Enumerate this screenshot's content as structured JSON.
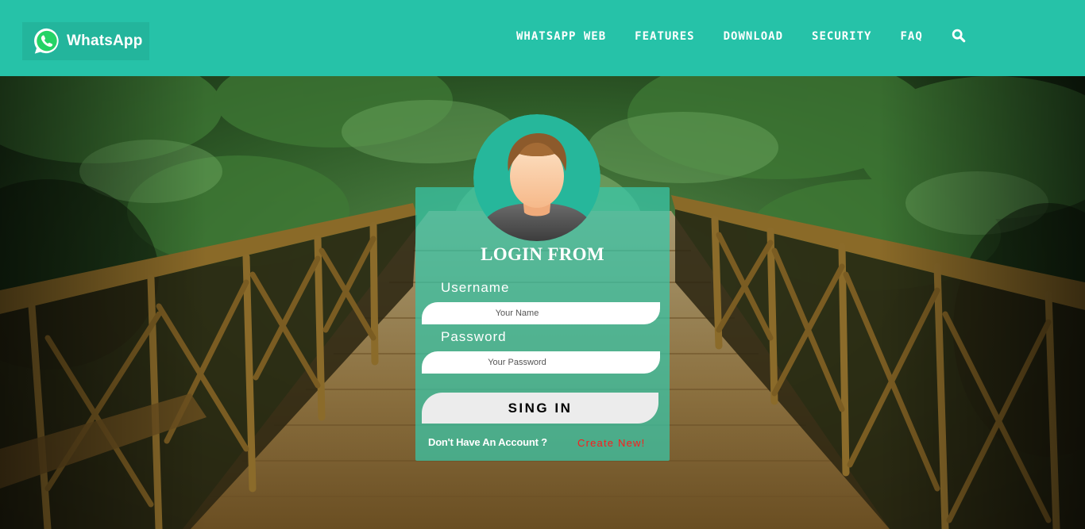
{
  "header": {
    "logo_text": "WhatsApp",
    "logo_icon": "whatsapp-logo-icon",
    "nav": [
      {
        "label": "WHATSAPP WEB"
      },
      {
        "label": "FEATURES"
      },
      {
        "label": "DOWNLOAD"
      },
      {
        "label": "SECURITY"
      },
      {
        "label": "FAQ"
      }
    ],
    "search_icon": "search-icon"
  },
  "login": {
    "avatar_icon": "user-avatar-icon",
    "title": "LOGIN FROM",
    "username_label": "Username",
    "username_placeholder": "Your Name",
    "password_label": "Password",
    "password_placeholder": "Your Password",
    "submit_label": "SING IN",
    "no_account_text": "Don't Have An Account ?",
    "create_link": "Create New!"
  },
  "colors": {
    "header_bg": "#26c2a8",
    "card_bg": "#37c8aa",
    "create_link": "#ff1a1a"
  }
}
